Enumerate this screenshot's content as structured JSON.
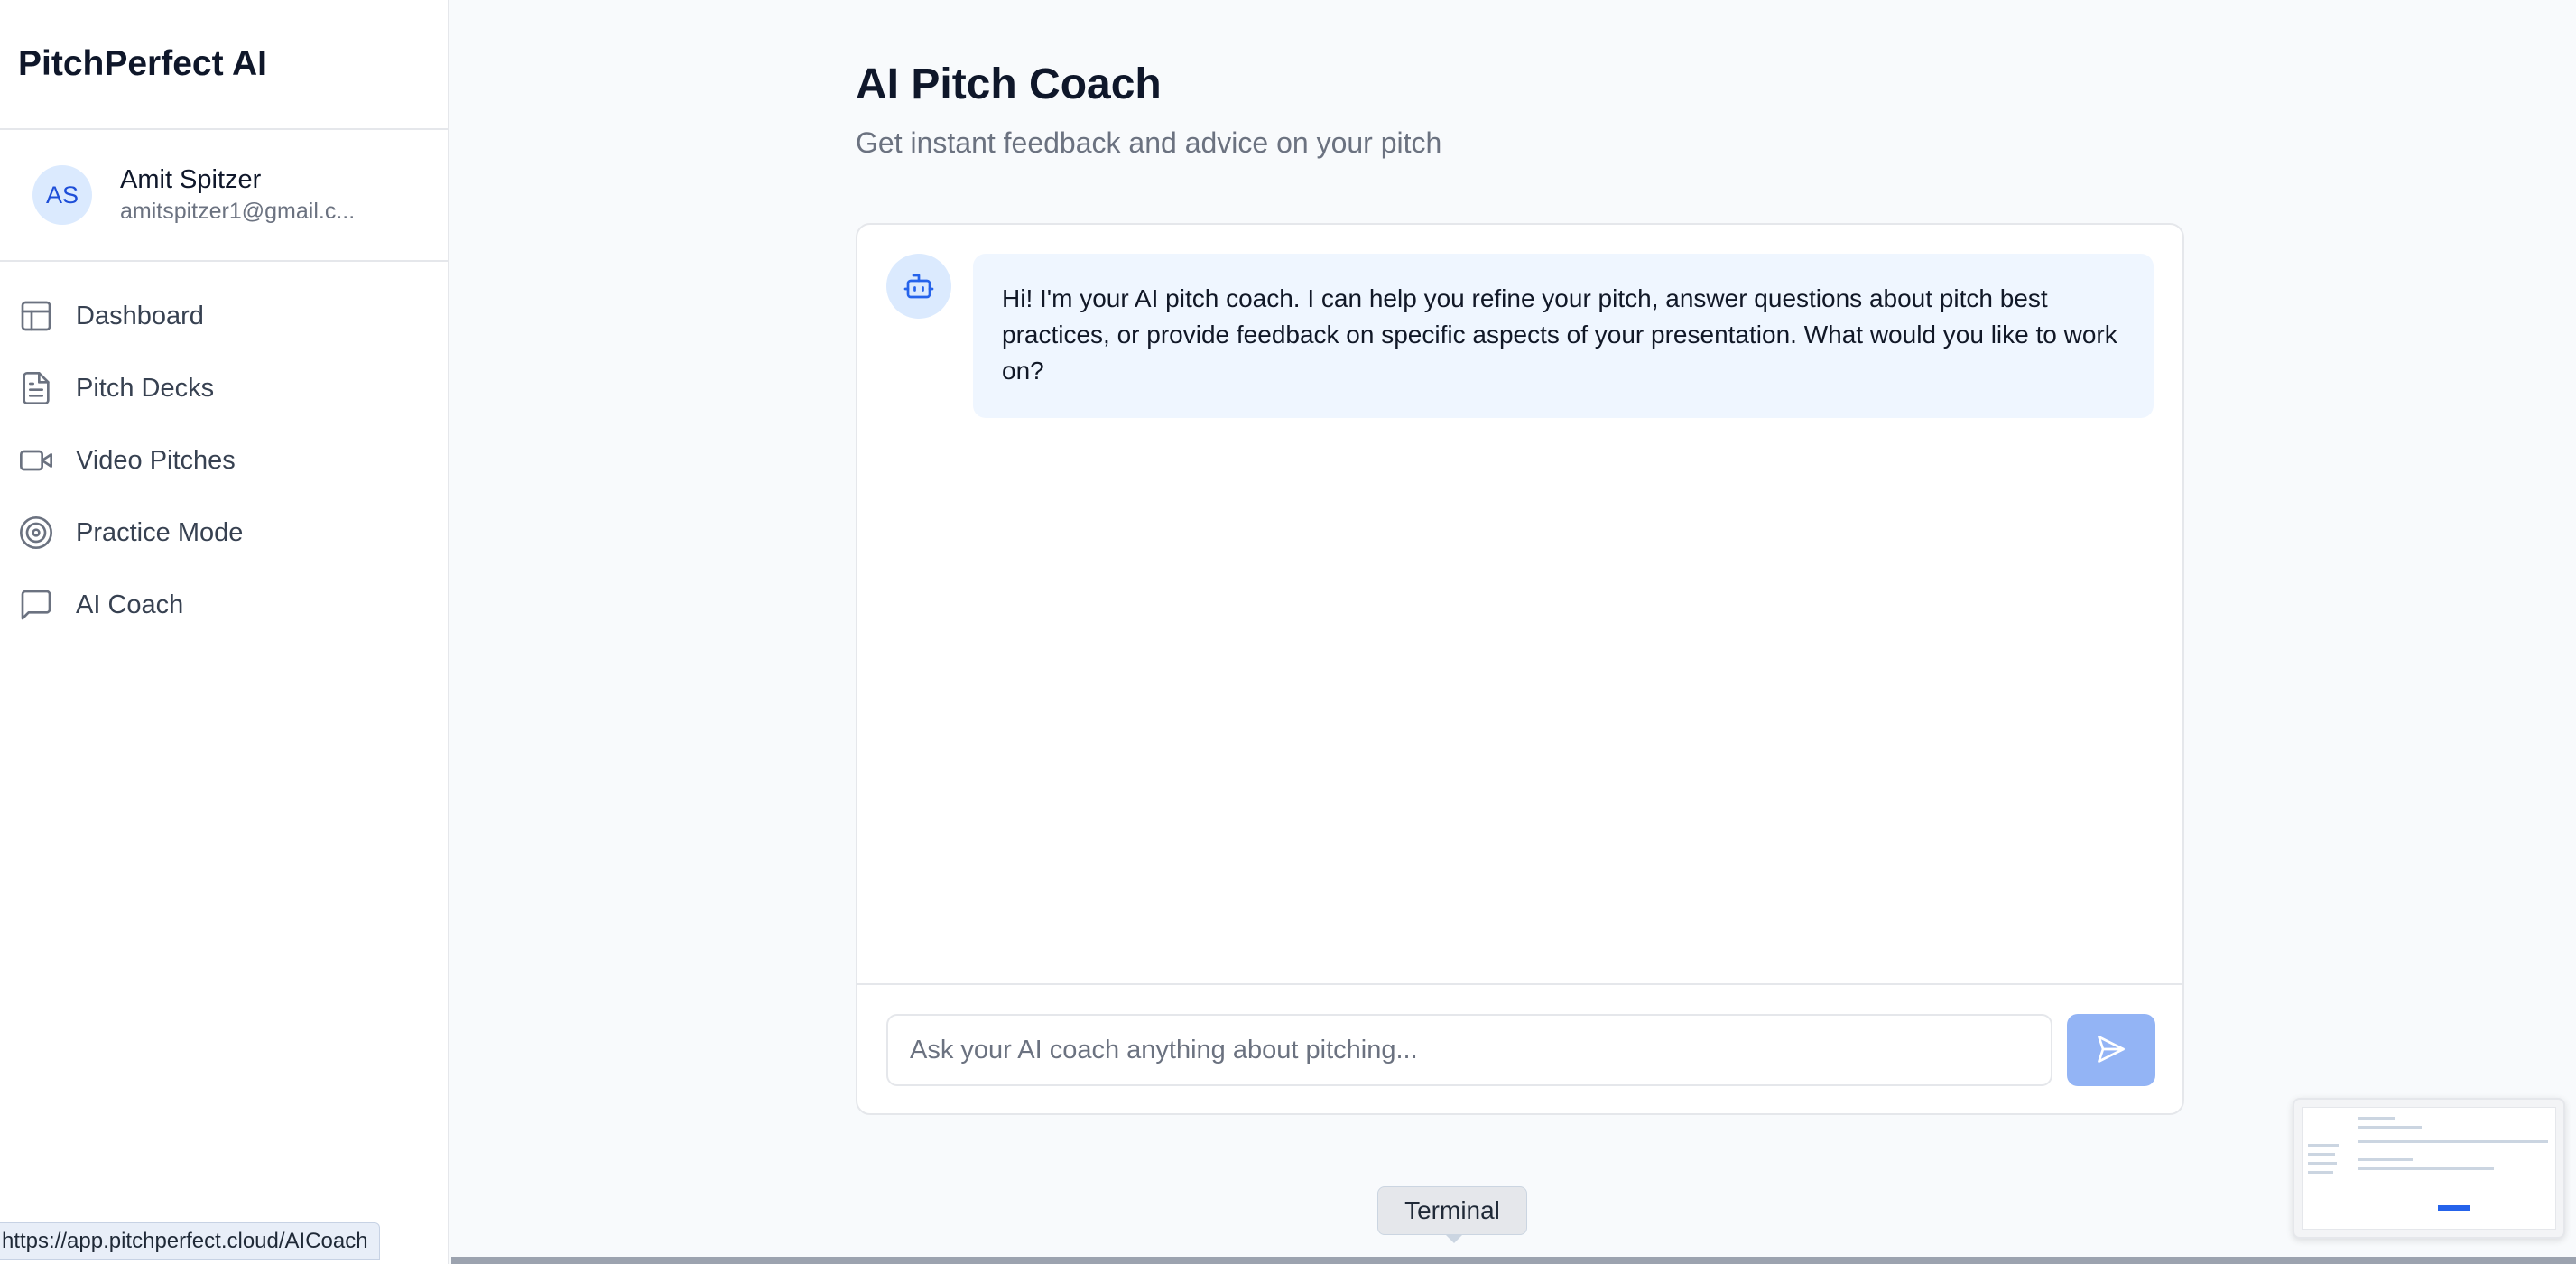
{
  "app": {
    "brand": "PitchPerfect AI"
  },
  "user": {
    "initials": "AS",
    "name": "Amit Spitzer",
    "email": "amitspitzer1@gmail.c..."
  },
  "sidebar": {
    "items": [
      {
        "label": "Dashboard",
        "icon": "layout-icon"
      },
      {
        "label": "Pitch Decks",
        "icon": "document-icon"
      },
      {
        "label": "Video Pitches",
        "icon": "video-icon"
      },
      {
        "label": "Practice Mode",
        "icon": "target-icon"
      },
      {
        "label": "AI Coach",
        "icon": "message-icon"
      }
    ]
  },
  "main": {
    "title": "AI Pitch Coach",
    "subtitle": "Get instant feedback and advice on your pitch"
  },
  "chat": {
    "messages": [
      {
        "sender": "bot",
        "text": "Hi! I'm your AI pitch coach. I can help you refine your pitch, answer questions about pitch best practices, or provide feedback on specific aspects of your presentation. What would you like to work on?"
      }
    ],
    "input_placeholder": "Ask your AI coach anything about pitching...",
    "input_value": "",
    "send_icon": "send-icon"
  },
  "overlays": {
    "status_url": "https://app.pitchperfect.cloud/AICoach",
    "tooltip": "Terminal"
  },
  "colors": {
    "accent": "#2563eb",
    "avatar_bg": "#dbeafe",
    "bubble_bg": "#eff6ff",
    "send_button_bg": "#93b4f5",
    "background": "#f8fafc"
  }
}
